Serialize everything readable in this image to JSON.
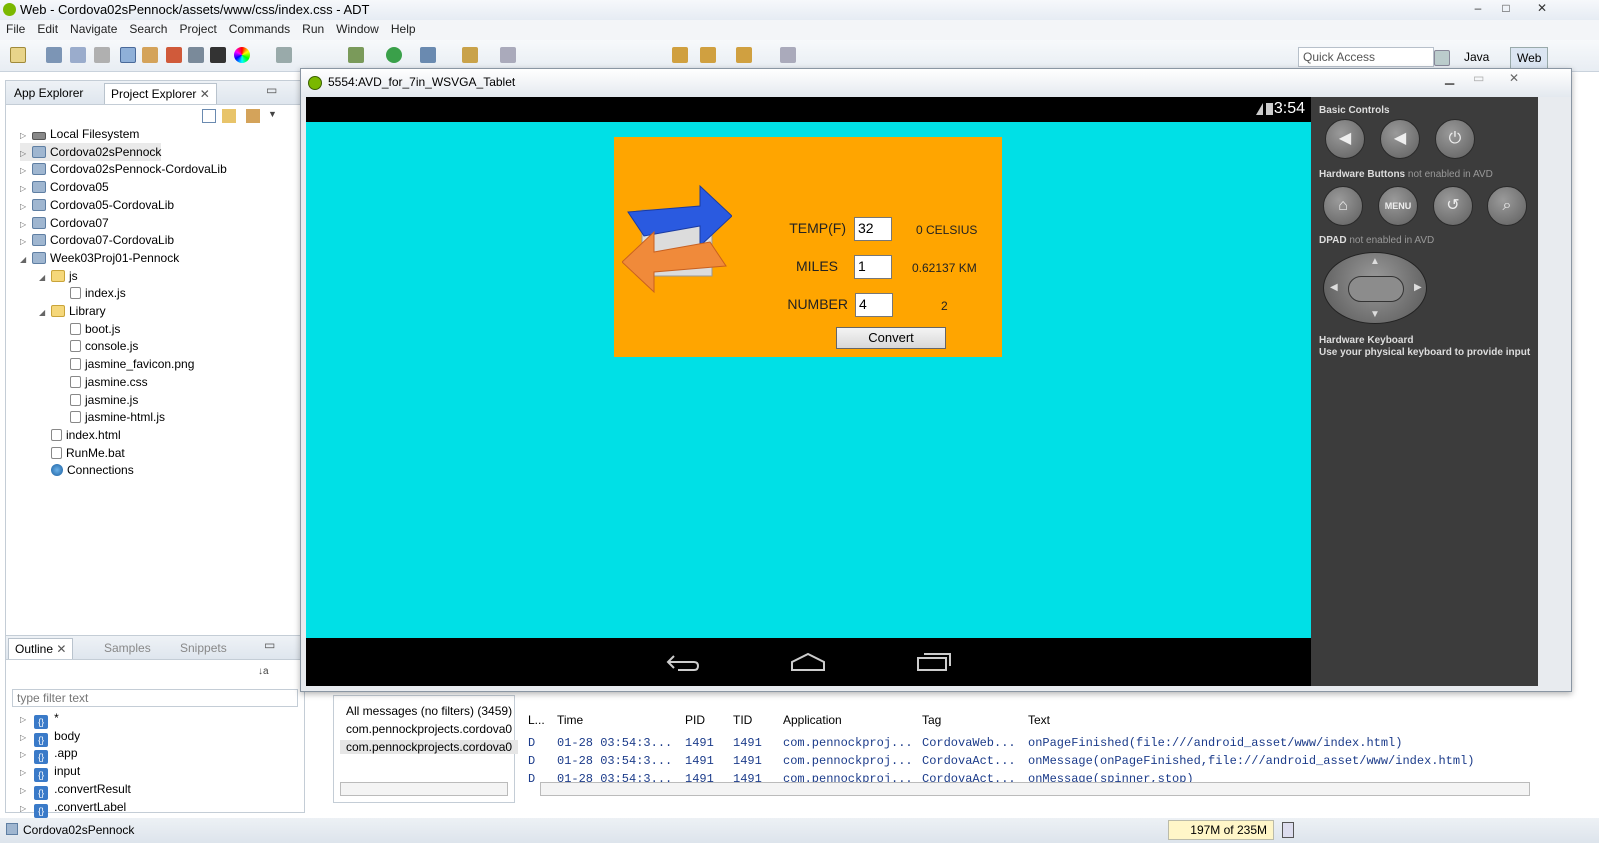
{
  "window": {
    "title": "Web - Cordova02sPennock/assets/www/css/index.css - ADT",
    "controls": [
      "–",
      "□",
      "✕"
    ]
  },
  "menu": [
    "File",
    "Edit",
    "Navigate",
    "Search",
    "Project",
    "Commands",
    "Run",
    "Window",
    "Help"
  ],
  "quick_access": {
    "placeholder": "Quick Access"
  },
  "perspectives": [
    "Java",
    "Web"
  ],
  "explorer": {
    "tabs": [
      "App Explorer",
      "Project Explorer"
    ],
    "tree": [
      {
        "label": "Local Filesystem",
        "icon": "disk-icon",
        "depth": 0,
        "toggle": "▷"
      },
      {
        "label": "Cordova02sPennock",
        "icon": "project-icon",
        "depth": 0,
        "toggle": "▷",
        "selected": true
      },
      {
        "label": "Cordova02sPennock-CordovaLib",
        "icon": "project-icon",
        "depth": 0,
        "toggle": "▷"
      },
      {
        "label": "Cordova05",
        "icon": "project-icon",
        "depth": 0,
        "toggle": "▷"
      },
      {
        "label": "Cordova05-CordovaLib",
        "icon": "project-icon",
        "depth": 0,
        "toggle": "▷"
      },
      {
        "label": "Cordova07",
        "icon": "project-icon",
        "depth": 0,
        "toggle": "▷"
      },
      {
        "label": "Cordova07-CordovaLib",
        "icon": "project-icon",
        "depth": 0,
        "toggle": "▷"
      },
      {
        "label": "Week03Proj01-Pennock",
        "icon": "project-icon",
        "depth": 0,
        "toggle": "◢"
      },
      {
        "label": "js",
        "icon": "folder-icon",
        "depth": 1,
        "toggle": "◢"
      },
      {
        "label": "index.js",
        "icon": "file-icon",
        "depth": 2,
        "toggle": ""
      },
      {
        "label": "Library",
        "icon": "folder-icon",
        "depth": 1,
        "toggle": "◢"
      },
      {
        "label": "boot.js",
        "icon": "file-icon",
        "depth": 2,
        "toggle": ""
      },
      {
        "label": "console.js",
        "icon": "file-icon",
        "depth": 2,
        "toggle": ""
      },
      {
        "label": "jasmine_favicon.png",
        "icon": "file-icon",
        "depth": 2,
        "toggle": ""
      },
      {
        "label": "jasmine.css",
        "icon": "file-icon",
        "depth": 2,
        "toggle": ""
      },
      {
        "label": "jasmine.js",
        "icon": "file-icon",
        "depth": 2,
        "toggle": ""
      },
      {
        "label": "jasmine-html.js",
        "icon": "file-icon",
        "depth": 2,
        "toggle": ""
      },
      {
        "label": "index.html",
        "icon": "file-icon",
        "depth": 1,
        "toggle": ""
      },
      {
        "label": "RunMe.bat",
        "icon": "file-icon",
        "depth": 1,
        "toggle": ""
      },
      {
        "label": "Connections",
        "icon": "globe-icon",
        "depth": 1,
        "toggle": ""
      }
    ]
  },
  "outline": {
    "tabs": [
      "Outline",
      "Samples",
      "Snippets"
    ],
    "filter_placeholder": "type filter text",
    "items": [
      "*",
      "body",
      ".app",
      "input",
      ".convertResult",
      ".convertLabel"
    ]
  },
  "logcat": {
    "filters": [
      "All messages (no filters) (3459)",
      "com.pennockprojects.cordova0",
      "com.pennockprojects.cordova0"
    ],
    "columns": [
      "L...",
      "Time",
      "PID",
      "TID",
      "Application",
      "Tag",
      "Text"
    ],
    "rows": [
      [
        "D",
        "01-28 03:54:3...",
        "1491",
        "1491",
        "com.pennockproj...",
        "CordovaWeb...",
        "onPageFinished(file:///android_asset/www/index.html)"
      ],
      [
        "D",
        "01-28 03:54:3...",
        "1491",
        "1491",
        "com.pennockproj...",
        "CordovaAct...",
        "onMessage(onPageFinished,file:///android_asset/www/index.html)"
      ],
      [
        "D",
        "01-28 03:54:3...",
        "1491",
        "1491",
        "com.pennockproj...",
        "CordovaAct...",
        "onMessage(spinner,stop)"
      ]
    ]
  },
  "statusbar": {
    "selection": "Cordova02sPennock",
    "heap": "197M of 235M"
  },
  "emulator": {
    "title": "5554:AVD_for_7in_WSVGA_Tablet",
    "clock": "3:54",
    "app": {
      "fields": [
        {
          "label": "TEMP(F)",
          "value": "32",
          "result": "0 CELSIUS"
        },
        {
          "label": "MILES",
          "value": "1",
          "result": "0.62137 KM"
        },
        {
          "label": "NUMBER",
          "value": "4",
          "result": "2"
        }
      ],
      "convert_label": "Convert"
    },
    "controls": {
      "basic": "Basic Controls",
      "hardware_buttons": "Hardware Buttons",
      "hardware_note": "not enabled in AVD",
      "dpad": "DPAD",
      "dpad_note": "not enabled in AVD",
      "keyboard": "Hardware Keyboard",
      "keyboard_note": "Use your physical keyboard to provide input",
      "menu_label": "MENU"
    },
    "colors": {
      "screen": "#00e0e6",
      "app_bg": "#ffa500"
    }
  }
}
